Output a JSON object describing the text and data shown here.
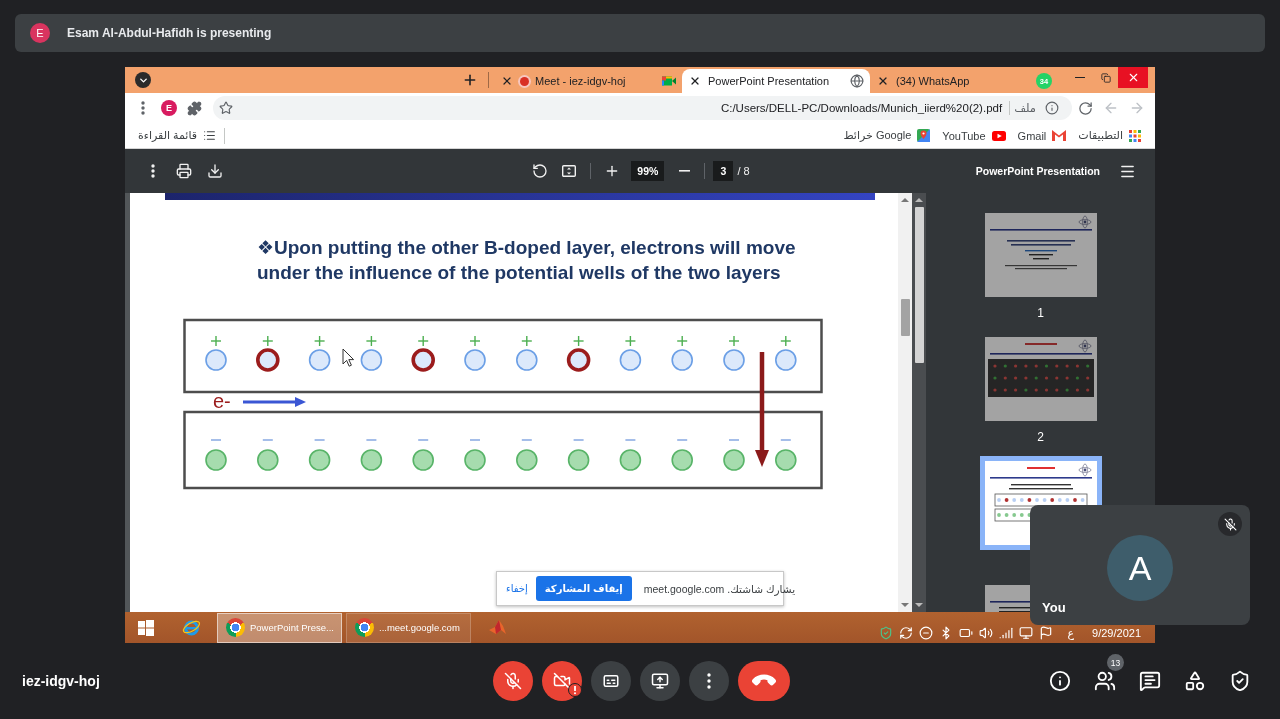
{
  "presenter": {
    "initial": "E",
    "text": "Esam Al-Abdul-Hafidh is presenting"
  },
  "browser": {
    "tabs": [
      {
        "kind": "meet",
        "title": "Meet - iez-idgv-hoj",
        "selected": false,
        "recording": true
      },
      {
        "kind": "document",
        "title": "PowerPoint Presentation",
        "selected": true,
        "recording": false
      },
      {
        "kind": "whatsapp",
        "title": "(34) WhatsApp",
        "badge": "34",
        "selected": false,
        "recording": false
      }
    ],
    "profile_initial": "E",
    "address": {
      "url": "C:/Users/DELL-PC/Downloads/Munich_iierd%20(2).pdf",
      "chip": "ملف"
    },
    "nav": [
      {
        "kind": "forward",
        "disabled": true
      },
      {
        "kind": "back",
        "disabled": true
      }
    ],
    "reading_list": "قائمة القراءة",
    "bookmarks": [
      {
        "kind": "maps",
        "label": "خرائط Google"
      },
      {
        "kind": "youtube",
        "label": "YouTube"
      },
      {
        "kind": "gmail",
        "label": "Gmail"
      },
      {
        "kind": "apps",
        "label": "التطبيقات"
      }
    ]
  },
  "pdf_viewer": {
    "zoom": "99%",
    "page": "3",
    "page_total": "/ 8",
    "title": "PowerPoint Presentation",
    "slide": {
      "title": "❖Upon putting the other B-doped layer, electrons will move under the influence of the potential wells of the two layers",
      "electron_label": "e-",
      "layers": [
        {
          "kind": "positive",
          "particles": [
            {
              "marked": false
            },
            {
              "marked": true
            },
            {
              "marked": false
            },
            {
              "marked": false
            },
            {
              "marked": true
            },
            {
              "marked": false
            },
            {
              "marked": false
            },
            {
              "marked": true
            },
            {
              "marked": false
            },
            {
              "marked": false
            },
            {
              "marked": false
            },
            {
              "marked": false
            }
          ]
        },
        {
          "kind": "negative",
          "particles": [
            {
              "marked": false
            },
            {
              "marked": false
            },
            {
              "marked": false
            },
            {
              "marked": false
            },
            {
              "marked": false
            },
            {
              "marked": false
            },
            {
              "marked": false
            },
            {
              "marked": false
            },
            {
              "marked": false
            },
            {
              "marked": false
            },
            {
              "marked": false
            },
            {
              "marked": false
            }
          ]
        }
      ]
    },
    "thumbnails": [
      {
        "kind": "title",
        "label": "1",
        "selected": false
      },
      {
        "kind": "grid",
        "label": "2",
        "selected": false
      },
      {
        "kind": "diagram",
        "selected": true
      },
      {
        "kind": "text",
        "selected": false
      }
    ]
  },
  "share_bar": {
    "hide": "إخفاء",
    "stop": "إيقاف المشاركة",
    "message": "يشارك شاشتك. meet.google.com"
  },
  "taskbar": {
    "apps": [
      {
        "label": "PowerPoint Prese...",
        "selected": true
      },
      {
        "label": "...meet.google.com",
        "selected": false
      }
    ],
    "language": "ع",
    "date": "9/29/2021"
  },
  "self_view": {
    "initial": "A",
    "name": "You",
    "muted": true
  },
  "meeting": {
    "code": "iez-idgv-hoj",
    "controls": [
      {
        "kind": "microphone",
        "on": false
      },
      {
        "kind": "camera",
        "on": false,
        "warning": true
      },
      {
        "kind": "captions",
        "on": false
      },
      {
        "kind": "present"
      },
      {
        "kind": "more"
      },
      {
        "kind": "leave"
      }
    ],
    "side": [
      {
        "kind": "info"
      },
      {
        "kind": "people",
        "badge": "13"
      },
      {
        "kind": "chat"
      },
      {
        "kind": "activities"
      },
      {
        "kind": "host_controls"
      }
    ]
  }
}
